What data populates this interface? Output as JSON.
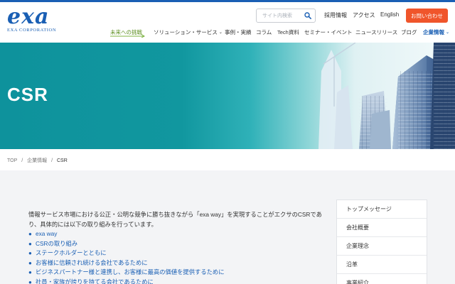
{
  "brand": {
    "logo_text": "exa",
    "logo_sub": "EXA CORPORATION",
    "accent": "#1a5fb4",
    "cta_color": "#f0552b"
  },
  "header": {
    "search_placeholder": "サイト内検索",
    "util_links": [
      "採用情報",
      "アクセス",
      "English"
    ],
    "contact_label": "お問い合わせ"
  },
  "nav": {
    "future": "未来への挑戦",
    "solutions": "ソリューション・サービス",
    "cases": "事例・実績",
    "column": "コラム",
    "tech": "Tech資料",
    "seminar": "セミナー・イベント",
    "news": "ニュースリリース",
    "blog": "ブログ",
    "company": "企業情報"
  },
  "hero": {
    "title": "CSR"
  },
  "breadcrumb": {
    "top": "TOP",
    "sep": "/",
    "parent": "企業情報",
    "current": "CSR"
  },
  "main": {
    "intro": "情報サービス市場における公正・公明な競争に勝ち抜きながら「exa way」を実現することがエクサのCSRであり、具体的には以下の取り組みを行っています。",
    "items": [
      "exa way",
      "CSRの取り組み",
      "ステークホルダーとともに",
      "お客様に信頼され続ける会社であるために",
      "ビジネスパートナー様と連携し、お客様に最高の価値を提供するために",
      "社員・家族が誇りを持てる会社であるために"
    ]
  },
  "sidebar": {
    "items": [
      "トップメッセージ",
      "会社概要",
      "企業理念",
      "沿革",
      "事業紹介"
    ]
  }
}
